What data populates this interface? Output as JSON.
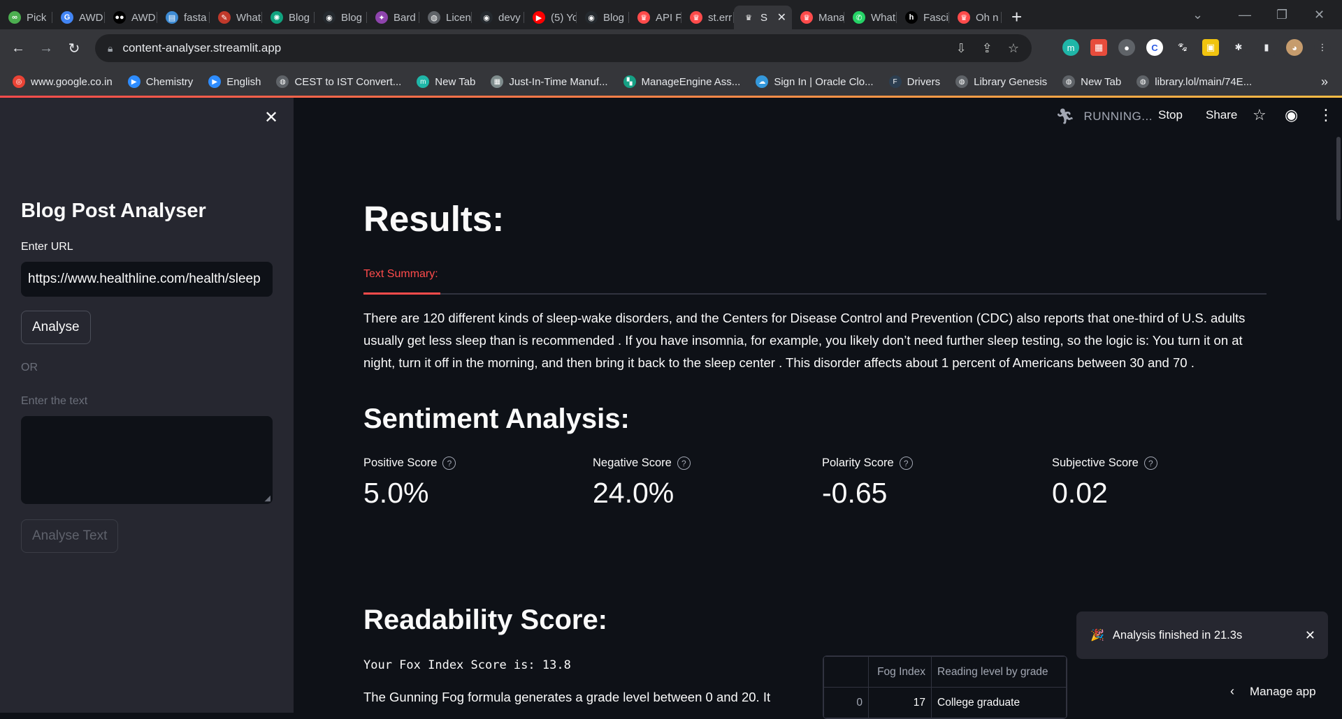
{
  "browser": {
    "tabs": [
      {
        "label": "Pick",
        "icon": "infinity-icon",
        "color": "#4caf50"
      },
      {
        "label": "AWD",
        "icon": "google-icon",
        "color": "#4285f4"
      },
      {
        "label": "AWD",
        "icon": "medium-icon",
        "color": "#000000"
      },
      {
        "label": "fasta",
        "icon": "doc-icon",
        "color": "#3d8bd4"
      },
      {
        "label": "What",
        "icon": "feather-icon",
        "color": "#c0392b"
      },
      {
        "label": "Blog",
        "icon": "openai-icon",
        "color": "#10a37f"
      },
      {
        "label": "Blog",
        "icon": "github-icon",
        "color": "#24292e"
      },
      {
        "label": "Bard",
        "icon": "sparkle-icon",
        "color": "#8e44ad"
      },
      {
        "label": "Licen",
        "icon": "globe-icon",
        "color": "#5f6368"
      },
      {
        "label": "devy",
        "icon": "github-icon",
        "color": "#24292e"
      },
      {
        "label": "(5) Yo",
        "icon": "youtube-icon",
        "color": "#ff0000"
      },
      {
        "label": "Blog",
        "icon": "github-icon",
        "color": "#24292e"
      },
      {
        "label": "API F",
        "icon": "crown-icon",
        "color": "#ff4b4b"
      },
      {
        "label": "st.err",
        "icon": "crown-icon",
        "color": "#ff4b4b"
      },
      {
        "label": "S",
        "icon": "crown-icon",
        "color": "#ffffff",
        "active": true
      },
      {
        "label": "Mana",
        "icon": "crown-icon",
        "color": "#ff4b4b"
      },
      {
        "label": "What",
        "icon": "whatsapp-icon",
        "color": "#25d366"
      },
      {
        "label": "Fasci",
        "icon": "hashnode-icon",
        "color": "#000000"
      },
      {
        "label": "Oh n",
        "icon": "crown-icon",
        "color": "#ff4b4b"
      }
    ],
    "tab_close": "✕",
    "new_tab": "+",
    "url": "content-analyser.streamlit.app",
    "bookmarks": [
      {
        "label": "www.google.co.in",
        "icon": "chrome-icon",
        "color": "#ea4335"
      },
      {
        "label": "Chemistry",
        "icon": "zoom-icon",
        "color": "#2d8cff"
      },
      {
        "label": "English",
        "icon": "zoom-icon",
        "color": "#2d8cff"
      },
      {
        "label": "CEST to IST Convert...",
        "icon": "globe-icon",
        "color": "#5f6368"
      },
      {
        "label": "New Tab",
        "icon": "m-icon",
        "color": "#1fb6a8"
      },
      {
        "label": "Just-In-Time Manuf...",
        "icon": "grid-icon",
        "color": "#7f8c8d"
      },
      {
        "label": "ManageEngine Ass...",
        "icon": "manageengine-icon",
        "color": "#16a085"
      },
      {
        "label": "Sign In | Oracle Clo...",
        "icon": "cloud-icon",
        "color": "#3498db"
      },
      {
        "label": "Drivers",
        "icon": "ftx-icon",
        "color": "#2c3e50"
      },
      {
        "label": "Library Genesis",
        "icon": "globe-icon",
        "color": "#5f6368"
      },
      {
        "label": "New Tab",
        "icon": "globe-icon",
        "color": "#5f6368"
      },
      {
        "label": "library.lol/main/74E...",
        "icon": "globe-icon",
        "color": "#5f6368"
      }
    ]
  },
  "sidebar": {
    "close": "✕",
    "title": "Blog Post Analyser",
    "url_label": "Enter URL",
    "url_value": "https://www.healthline.com/health/sleep",
    "analyse_button": "Analyse",
    "or_label": "OR",
    "text_label": "Enter the text",
    "analyse_text_button": "Analyse Text"
  },
  "header": {
    "status": "RUNNING...",
    "stop": "Stop",
    "share": "Share"
  },
  "main": {
    "results_title": "Results:",
    "tab_label": "Text Summary:",
    "summary": "There are 120 different kinds of sleep-wake disorders, and the Centers for Disease Control and Prevention (CDC) also reports that one-third of U.S. adults usually get less sleep than is recommended . If you have insomnia, for example, you likely don’t need further sleep testing, so the logic is: You turn it on at night, turn it off in the morning, and then bring it back to the sleep center . This disorder affects about 1 percent of Americans between 30 and 70 .",
    "sentiment_title": "Sentiment Analysis:",
    "metrics": [
      {
        "label": "Positive Score",
        "value": "5.0%"
      },
      {
        "label": "Negative Score",
        "value": "24.0%"
      },
      {
        "label": "Polarity Score",
        "value": "-0.65"
      },
      {
        "label": "Subjective Score",
        "value": "0.02"
      }
    ],
    "readability_title": "Readability Score:",
    "fox_index": "Your Fox Index Score is: 13.8",
    "gunning_text": "The Gunning Fog formula generates a grade level between 0 and 20. It",
    "table": {
      "headers": [
        "",
        "Fog Index",
        "Reading level by grade"
      ],
      "rows": [
        [
          "0",
          "17",
          "College graduate"
        ]
      ]
    }
  },
  "toast": {
    "icon": "🎉",
    "message": "Analysis finished in 21.3s",
    "close": "✕"
  },
  "manage_app": "Manage app"
}
